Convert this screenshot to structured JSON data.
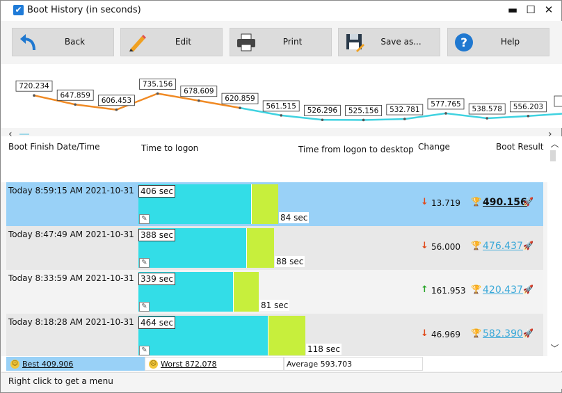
{
  "window": {
    "title": "Boot History (in seconds)",
    "minimize_glyph": "▬",
    "maximize_glyph": "☐",
    "close_glyph": "✕"
  },
  "toolbar": [
    {
      "label": "Back",
      "icon": "back-arrow-icon"
    },
    {
      "label": "Edit",
      "icon": "pencil-icon"
    },
    {
      "label": "Print",
      "icon": "printer-icon"
    },
    {
      "label": "Save as...",
      "icon": "floppy-disk-icon"
    },
    {
      "label": "Help",
      "icon": "question-icon"
    }
  ],
  "chart_data": {
    "type": "line",
    "title": "",
    "xlabel": "",
    "ylabel": "",
    "values": [
      720.234,
      647.859,
      606.453,
      735.156,
      678.609,
      620.859,
      561.515,
      526.296,
      525.156,
      532.781,
      577.765,
      538.578,
      556.203
    ],
    "labels": [
      "720.234",
      "647.859",
      "606.453",
      "735.156",
      "678.609",
      "620.859",
      "561.515",
      "526.296",
      "525.156",
      "532.781",
      "577.765",
      "538.578",
      "556.203"
    ],
    "colors": {
      "above": "#f08a24",
      "below": "#3fd2e0"
    },
    "threshold": 593.703
  },
  "headers": {
    "date": "Boot Finish Date/Time",
    "logon": "Time to logon",
    "desktop": "Time from logon to desktop",
    "change": "Change",
    "result": "Boot Result"
  },
  "rows": [
    {
      "date": "Today  8:59:15 AM 2021-10-31",
      "logon": "406 sec",
      "logon_value": 406,
      "desktop": "84 sec",
      "desktop_value": 84,
      "direction": "down",
      "change": "13.719",
      "result": "490.156",
      "selected": true
    },
    {
      "date": "Today  8:47:49 AM 2021-10-31",
      "logon": "388 sec",
      "logon_value": 388,
      "desktop": "88 sec",
      "desktop_value": 88,
      "direction": "down",
      "change": "56.000",
      "result": "476.437",
      "selected": false
    },
    {
      "date": "Today  8:33:59 AM 2021-10-31",
      "logon": "339 sec",
      "logon_value": 339,
      "desktop": "81 sec",
      "desktop_value": 81,
      "direction": "up",
      "change": "161.953",
      "result": "420.437",
      "selected": false
    },
    {
      "date": "Today  8:18:28 AM 2021-10-31",
      "logon": "464 sec",
      "logon_value": 464,
      "desktop": "118 sec",
      "desktop_value": 118,
      "direction": "down",
      "change": "46.969",
      "result": "582.390",
      "selected": false
    }
  ],
  "status": {
    "best": "Best 409.906",
    "worst": "Worst 872.078",
    "average": "Average 593.703"
  },
  "hint": "Right click to get a menu",
  "colors": {
    "selected_row": "#99d1f7",
    "row_even": "#e8e8e8",
    "row_odd": "#f3f3f3",
    "link": "#3aa8d8",
    "down_arrow": "#e04a1a",
    "up_arrow": "#2aa52a"
  }
}
